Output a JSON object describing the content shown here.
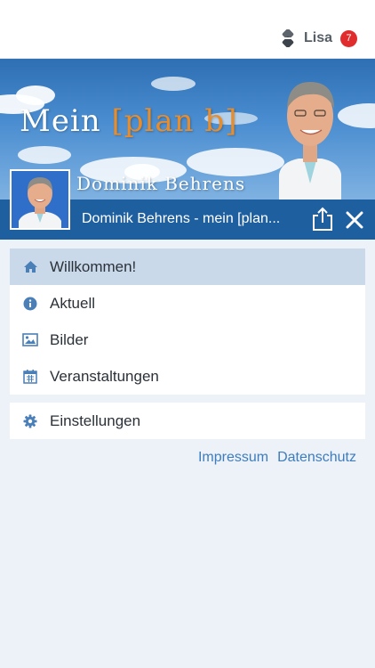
{
  "header": {
    "user_name": "Lisa",
    "notification_count": "7",
    "icons": [
      "app-logo-icon"
    ]
  },
  "banner": {
    "title_main": "Mein",
    "title_accent": "[plan b]",
    "subtitle": "Dominik Behrens"
  },
  "profile": {
    "title": "Dominik Behrens - mein [plan...",
    "icons": [
      "share-icon",
      "close-icon"
    ]
  },
  "menu": {
    "items": [
      {
        "label": "Willkommen!",
        "icon": "home-icon",
        "active": true
      },
      {
        "label": "Aktuell",
        "icon": "info-icon",
        "active": false
      },
      {
        "label": "Bilder",
        "icon": "image-icon",
        "active": false
      },
      {
        "label": "Veranstaltungen",
        "icon": "calendar-icon",
        "active": false
      }
    ],
    "settings": {
      "label": "Einstellungen",
      "icon": "gear-icon"
    }
  },
  "footer": {
    "impressum": "Impressum",
    "datenschutz": "Datenschutz"
  },
  "colors": {
    "primary": "#1e5fa0",
    "active_row": "#cad9ea",
    "background": "#edf1f8",
    "icon": "#4a7fb8",
    "badge": "#e02c2c",
    "accent_orange": "#e98d2b"
  }
}
